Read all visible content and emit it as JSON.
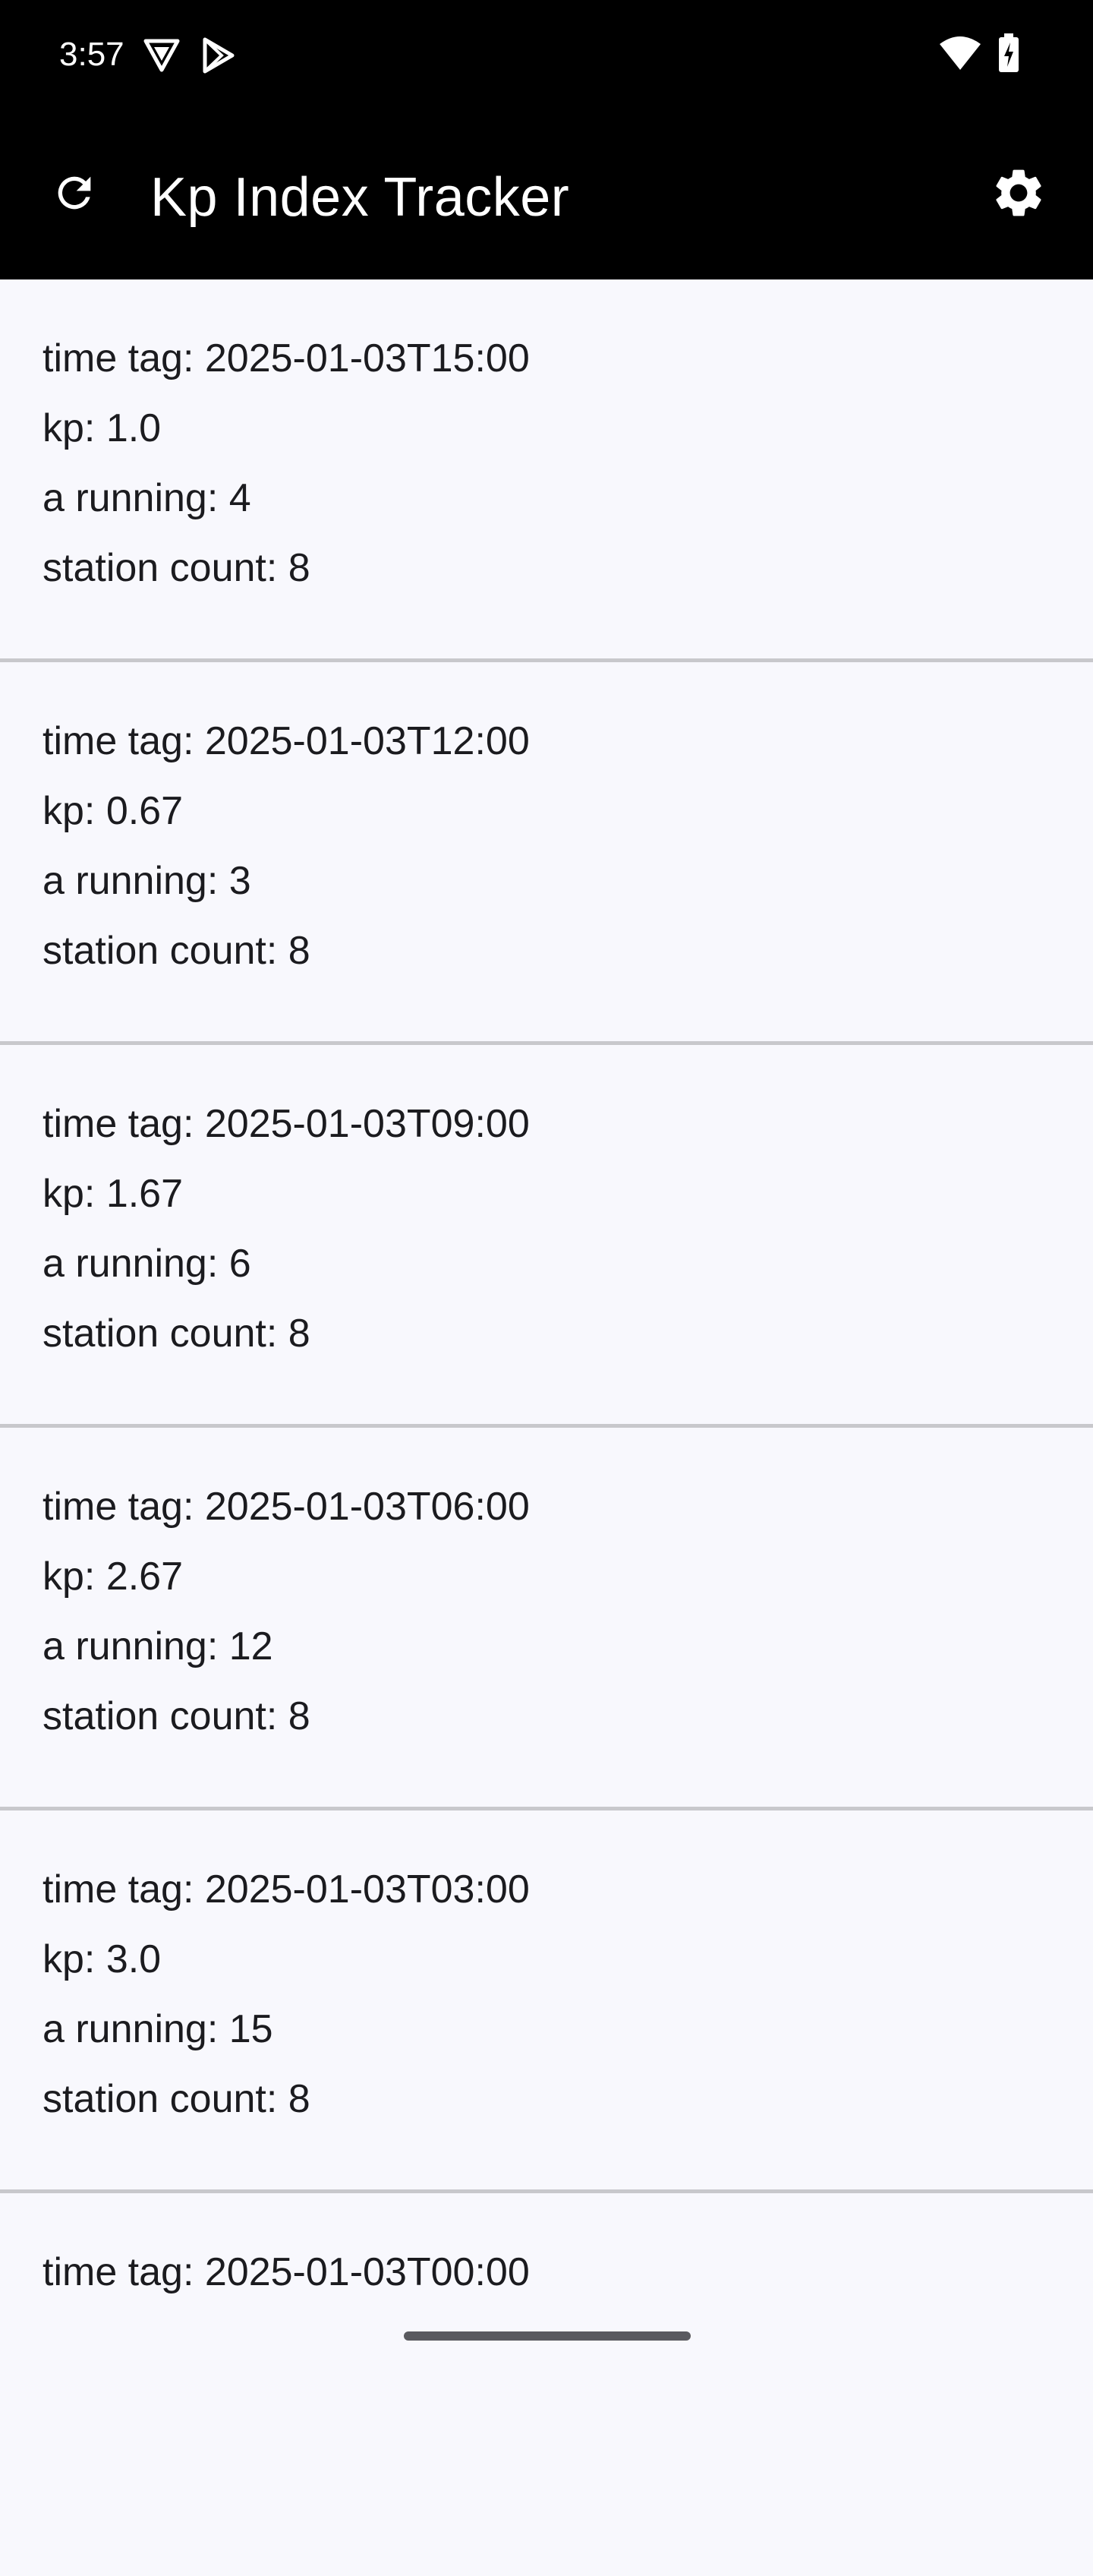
{
  "status_bar": {
    "time": "3:57",
    "icons": [
      "vpn-shield-icon",
      "play-store-icon",
      "wifi-icon",
      "battery-charging-icon"
    ]
  },
  "app_bar": {
    "title": "Kp Index Tracker",
    "refresh_icon": "refresh-icon",
    "settings_icon": "gear-icon"
  },
  "entries": [
    {
      "time_tag": "time tag: 2025-01-03T15:00",
      "kp": "kp: 1.0",
      "a_running": "a running: 4",
      "station_count": "station count: 8"
    },
    {
      "time_tag": "time tag: 2025-01-03T12:00",
      "kp": "kp: 0.67",
      "a_running": "a running: 3",
      "station_count": "station count: 8"
    },
    {
      "time_tag": "time tag: 2025-01-03T09:00",
      "kp": "kp: 1.67",
      "a_running": "a running: 6",
      "station_count": "station count: 8"
    },
    {
      "time_tag": "time tag: 2025-01-03T06:00",
      "kp": "kp: 2.67",
      "a_running": "a running: 12",
      "station_count": "station count: 8"
    },
    {
      "time_tag": "time tag: 2025-01-03T03:00",
      "kp": "kp: 3.0",
      "a_running": "a running: 15",
      "station_count": "station count: 8"
    },
    {
      "time_tag": "time tag: 2025-01-03T00:00"
    }
  ],
  "colors": {
    "bar_background": "#000000",
    "list_background": "#f8f8fd",
    "divider": "#c8c8cc",
    "text": "#1b1b1f"
  }
}
